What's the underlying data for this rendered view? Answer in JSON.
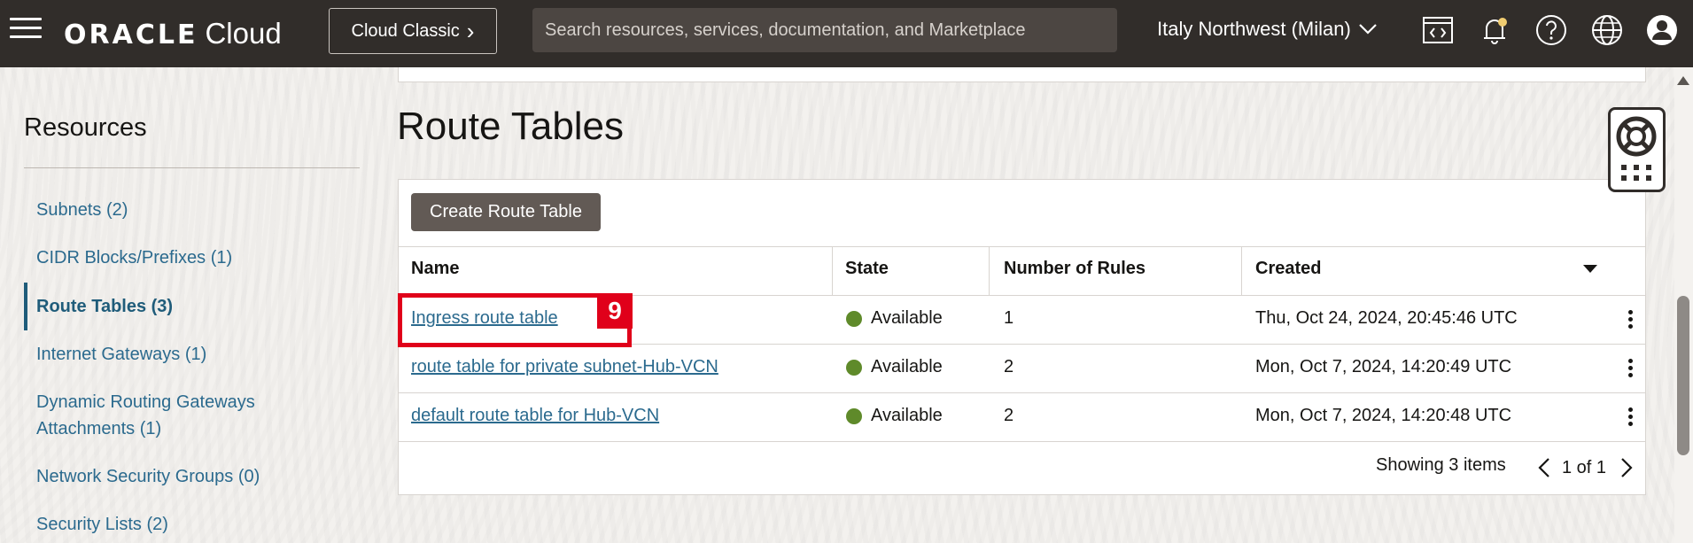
{
  "header": {
    "logo_brand": "ORACLE",
    "logo_product": "Cloud",
    "classic_label": "Cloud Classic",
    "classic_chevron": "›",
    "search_placeholder": "Search resources, services, documentation, and Marketplace",
    "region": "Italy Northwest (Milan)",
    "icons": [
      "hamburger-menu-icon",
      "code-editor-icon",
      "bell-icon",
      "help-icon",
      "globe-icon",
      "user-profile-icon"
    ]
  },
  "sidebar": {
    "title": "Resources",
    "items": [
      {
        "label": "Subnets (2)",
        "active": false
      },
      {
        "label": "CIDR Blocks/Prefixes (1)",
        "active": false
      },
      {
        "label": "Route Tables (3)",
        "active": true
      },
      {
        "label": "Internet Gateways (1)",
        "active": false
      },
      {
        "label": "Dynamic Routing Gateways Attachments (1)",
        "active": false
      },
      {
        "label": "Network Security Groups (0)",
        "active": false
      },
      {
        "label": "Security Lists (2)",
        "active": false
      }
    ]
  },
  "main": {
    "title": "Route Tables",
    "create_button": "Create Route Table",
    "columns": [
      "Name",
      "State",
      "Number of Rules",
      "Created"
    ],
    "rows": [
      {
        "name": "Ingress route table",
        "state": "Available",
        "rules": "1",
        "created": "Thu, Oct 24, 2024, 20:45:46 UTC"
      },
      {
        "name": "route table for private subnet-Hub-VCN",
        "state": "Available",
        "rules": "2",
        "created": "Mon, Oct 7, 2024, 14:20:49 UTC"
      },
      {
        "name": "default route table for Hub-VCN",
        "state": "Available",
        "rules": "2",
        "created": "Mon, Oct 7, 2024, 14:20:48 UTC"
      }
    ],
    "footer": {
      "showing": "Showing 3 items",
      "page": "1 of 1"
    },
    "annotation_badge": "9"
  },
  "colors": {
    "header_bg": "#312d2a",
    "link": "#2b6a8e",
    "available_dot": "#5f8a2a",
    "highlight": "#e0001a",
    "button_bg": "#625a55"
  }
}
